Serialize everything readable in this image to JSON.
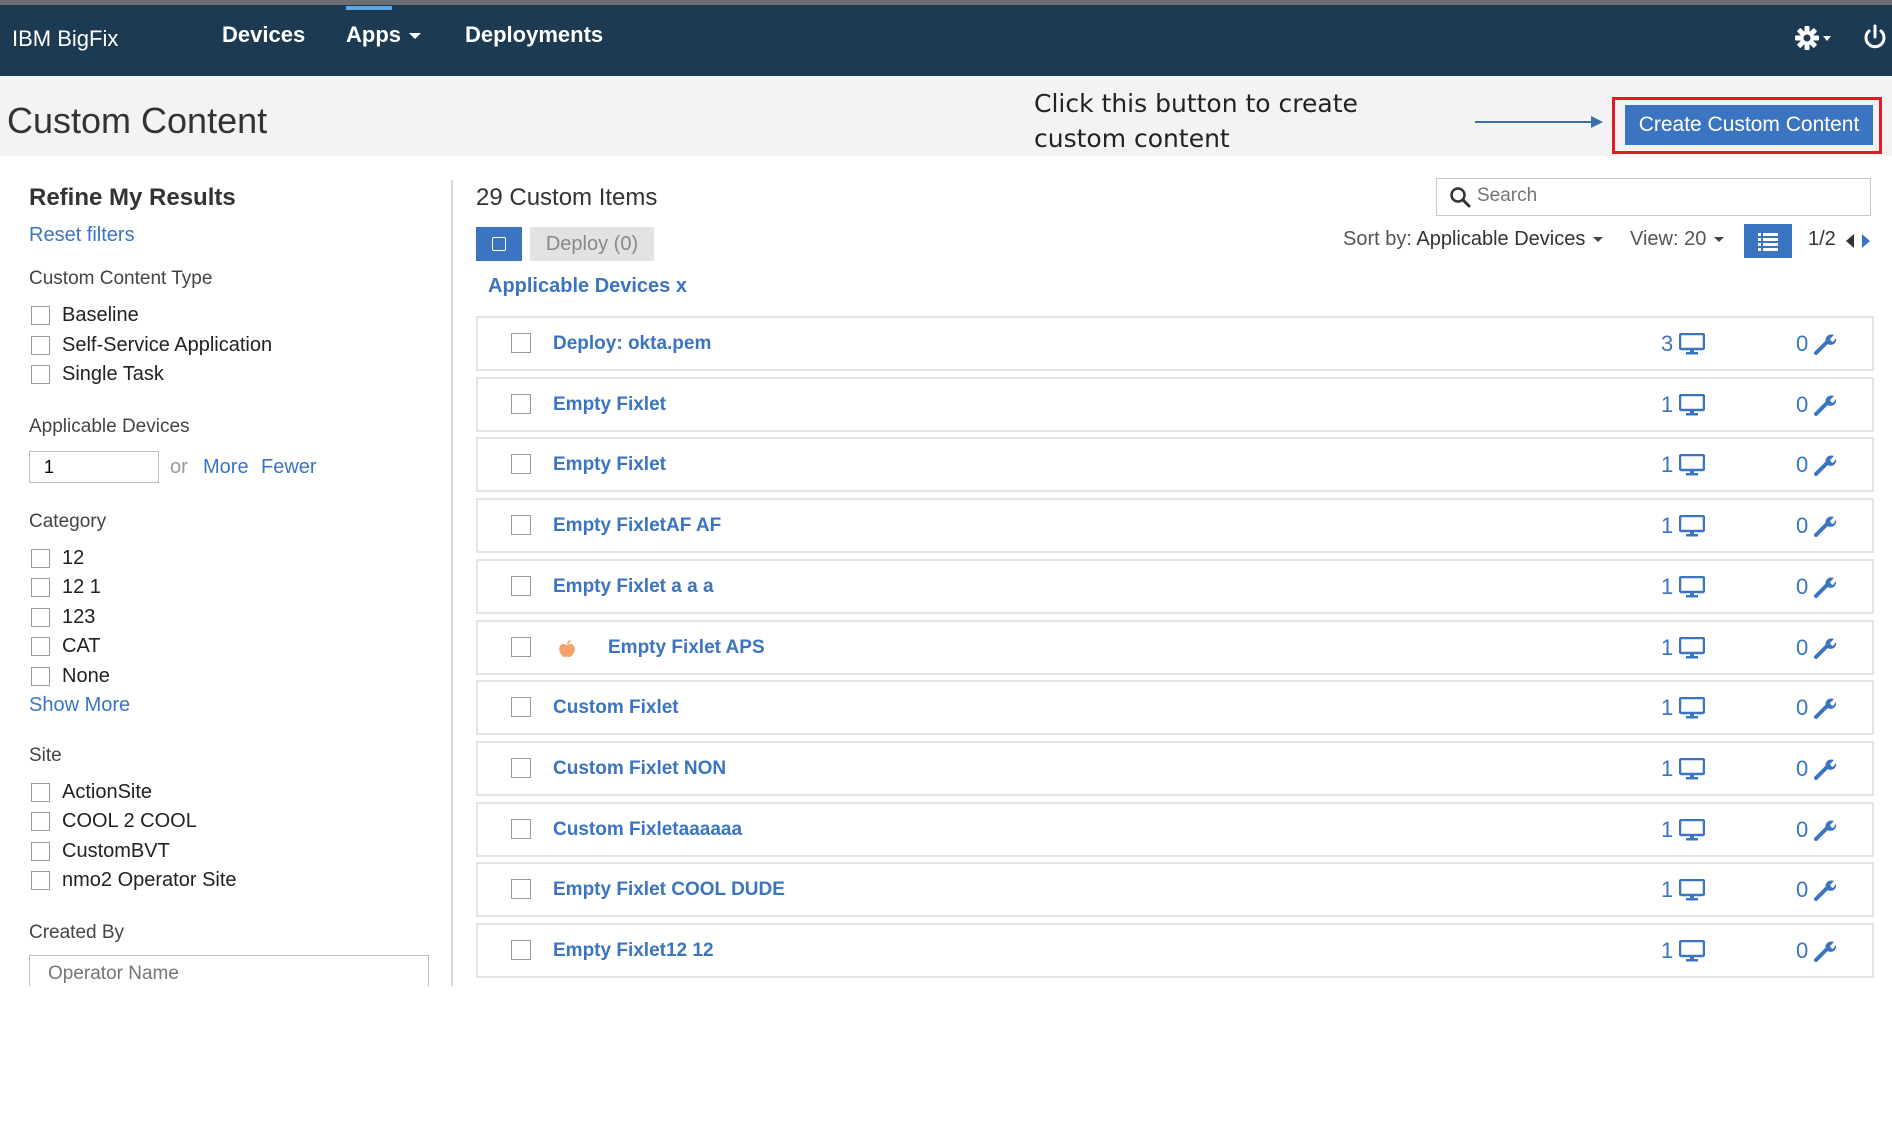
{
  "topbar": {
    "brand": "IBM BigFix",
    "nav": [
      {
        "label": "Devices"
      },
      {
        "label": "Apps"
      },
      {
        "label": "Deployments"
      }
    ]
  },
  "header": {
    "title": "Custom Content",
    "callout": "Click this button to create custom content",
    "create_button": "Create Custom Content"
  },
  "sidebar": {
    "title": "Refine My Results",
    "reset": "Reset filters",
    "content_type": {
      "label": "Custom Content Type",
      "options": [
        "Baseline",
        "Self-Service Application",
        "Single Task"
      ]
    },
    "applicable_devices": {
      "label": "Applicable Devices",
      "value": "1",
      "or": "or",
      "more": "More",
      "fewer": "Fewer"
    },
    "category": {
      "label": "Category",
      "options": [
        "12",
        "12 1",
        "123",
        "CAT",
        "None"
      ],
      "show_more": "Show More"
    },
    "site": {
      "label": "Site",
      "options": [
        "ActionSite",
        "COOL 2 COOL",
        "CustomBVT",
        "nmo2 Operator Site"
      ]
    },
    "created_by": {
      "label": "Created By",
      "placeholder": "Operator Name"
    }
  },
  "main": {
    "count": "29 Custom Items",
    "search_placeholder": "Search",
    "deploy_button": "Deploy (0)",
    "sort_label": "Sort by:",
    "sort_value": "Applicable Devices",
    "view": "View: 20",
    "pager": "1/2",
    "filter_chip": "Applicable Devices x",
    "items": [
      {
        "name": "Deploy: okta.pem",
        "devices": "3",
        "actions": "0"
      },
      {
        "name": "Empty Fixlet",
        "devices": "1",
        "actions": "0"
      },
      {
        "name": "Empty Fixlet",
        "devices": "1",
        "actions": "0"
      },
      {
        "name": "Empty FixletAF AF",
        "devices": "1",
        "actions": "0"
      },
      {
        "name": "Empty Fixlet a a a",
        "devices": "1",
        "actions": "0"
      },
      {
        "name": "Empty Fixlet APS",
        "devices": "1",
        "actions": "0",
        "apple": true
      },
      {
        "name": "Custom Fixlet",
        "devices": "1",
        "actions": "0"
      },
      {
        "name": "Custom Fixlet NON",
        "devices": "1",
        "actions": "0"
      },
      {
        "name": "Custom Fixletaaaaaa",
        "devices": "1",
        "actions": "0"
      },
      {
        "name": "Empty Fixlet COOL DUDE",
        "devices": "1",
        "actions": "0"
      },
      {
        "name": "Empty Fixlet12 12",
        "devices": "1",
        "actions": "0"
      }
    ]
  },
  "colors": {
    "nav_bg": "#1d3a53",
    "accent": "#3b74c0",
    "highlight": "#e01b22"
  }
}
